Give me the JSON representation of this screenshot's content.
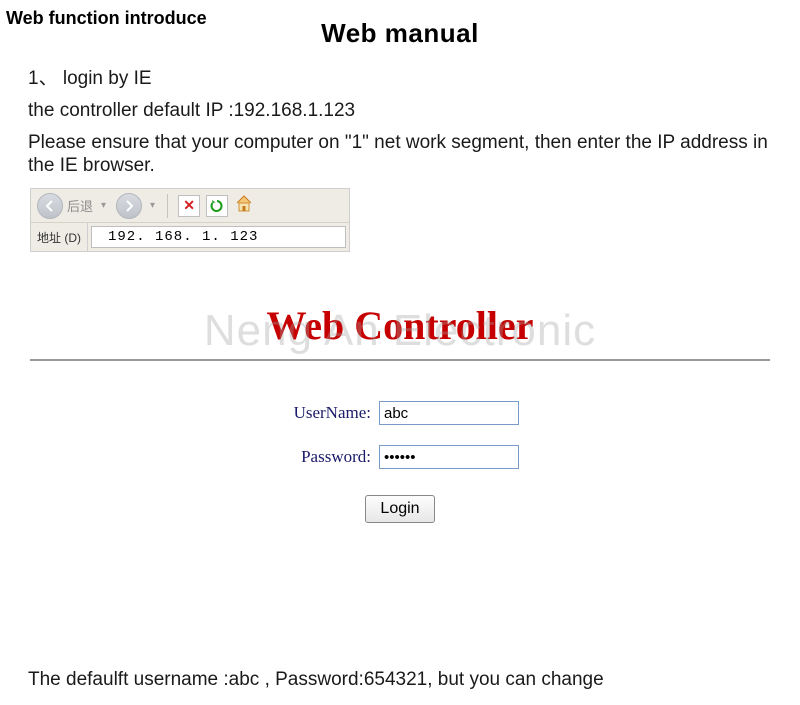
{
  "section_label": "Web function introduce",
  "page_title": "Web manual",
  "step1_line1": "1、 login by IE",
  "step1_line2": "the controller default IP :192.168.1.123",
  "step1_line3": "Please ensure that your computer on \"1\" net work segment, then enter the IP address in the IE browser.",
  "ie": {
    "back_label": "后退",
    "address_label": "地址 (D)",
    "address_value": "192. 168. 1. 123"
  },
  "login": {
    "title": "Web Controller",
    "watermark": "Neng An Electronic",
    "username_label": "UserName:",
    "username_value": "abc",
    "password_label": "Password:",
    "password_value": "654321",
    "button_label": "Login"
  },
  "footer": "The defaulft username :abc , Password:654321, but you can change"
}
